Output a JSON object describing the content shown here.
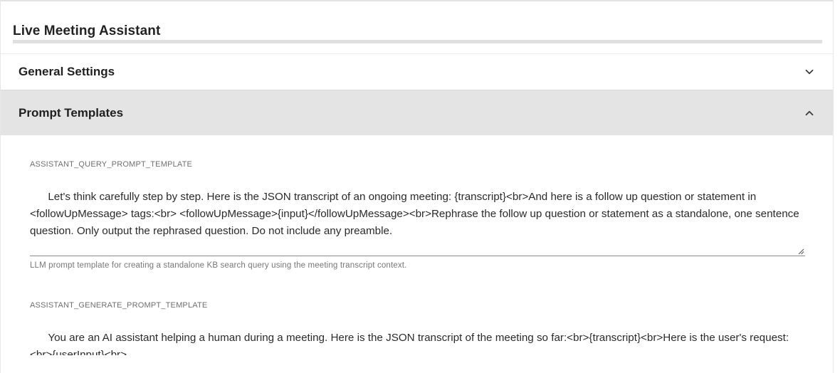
{
  "page": {
    "title": "Live Meeting Assistant"
  },
  "sections": [
    {
      "label": "General Settings",
      "expanded": false,
      "icon": "chevron-down-icon"
    },
    {
      "label": "Prompt Templates",
      "expanded": true,
      "icon": "chevron-up-icon"
    }
  ],
  "fields": [
    {
      "label": "ASSISTANT_QUERY_PROMPT_TEMPLATE",
      "value": "Let's think carefully step by step. Here is the JSON transcript of an ongoing meeting: {transcript}<br>And here is a follow up question or statement in <followUpMessage> tags:<br> <followUpMessage>{input}</followUpMessage><br>Rephrase the follow up question or statement as a standalone, one sentence question. Only output the rephrased question. Do not include any preamble.",
      "helper": "LLM prompt template for creating a standalone KB search query using the meeting transcript context."
    },
    {
      "label": "ASSISTANT_GENERATE_PROMPT_TEMPLATE",
      "value": "You are an AI assistant helping a human during a meeting. Here is the JSON transcript of the meeting so far:<br>{transcript}<br>Here is the user's request:<br>{userInput}<br>"
    }
  ],
  "colors": {
    "expanded_section_bg": "#e4e4e4",
    "divider": "#e0e0e0"
  }
}
